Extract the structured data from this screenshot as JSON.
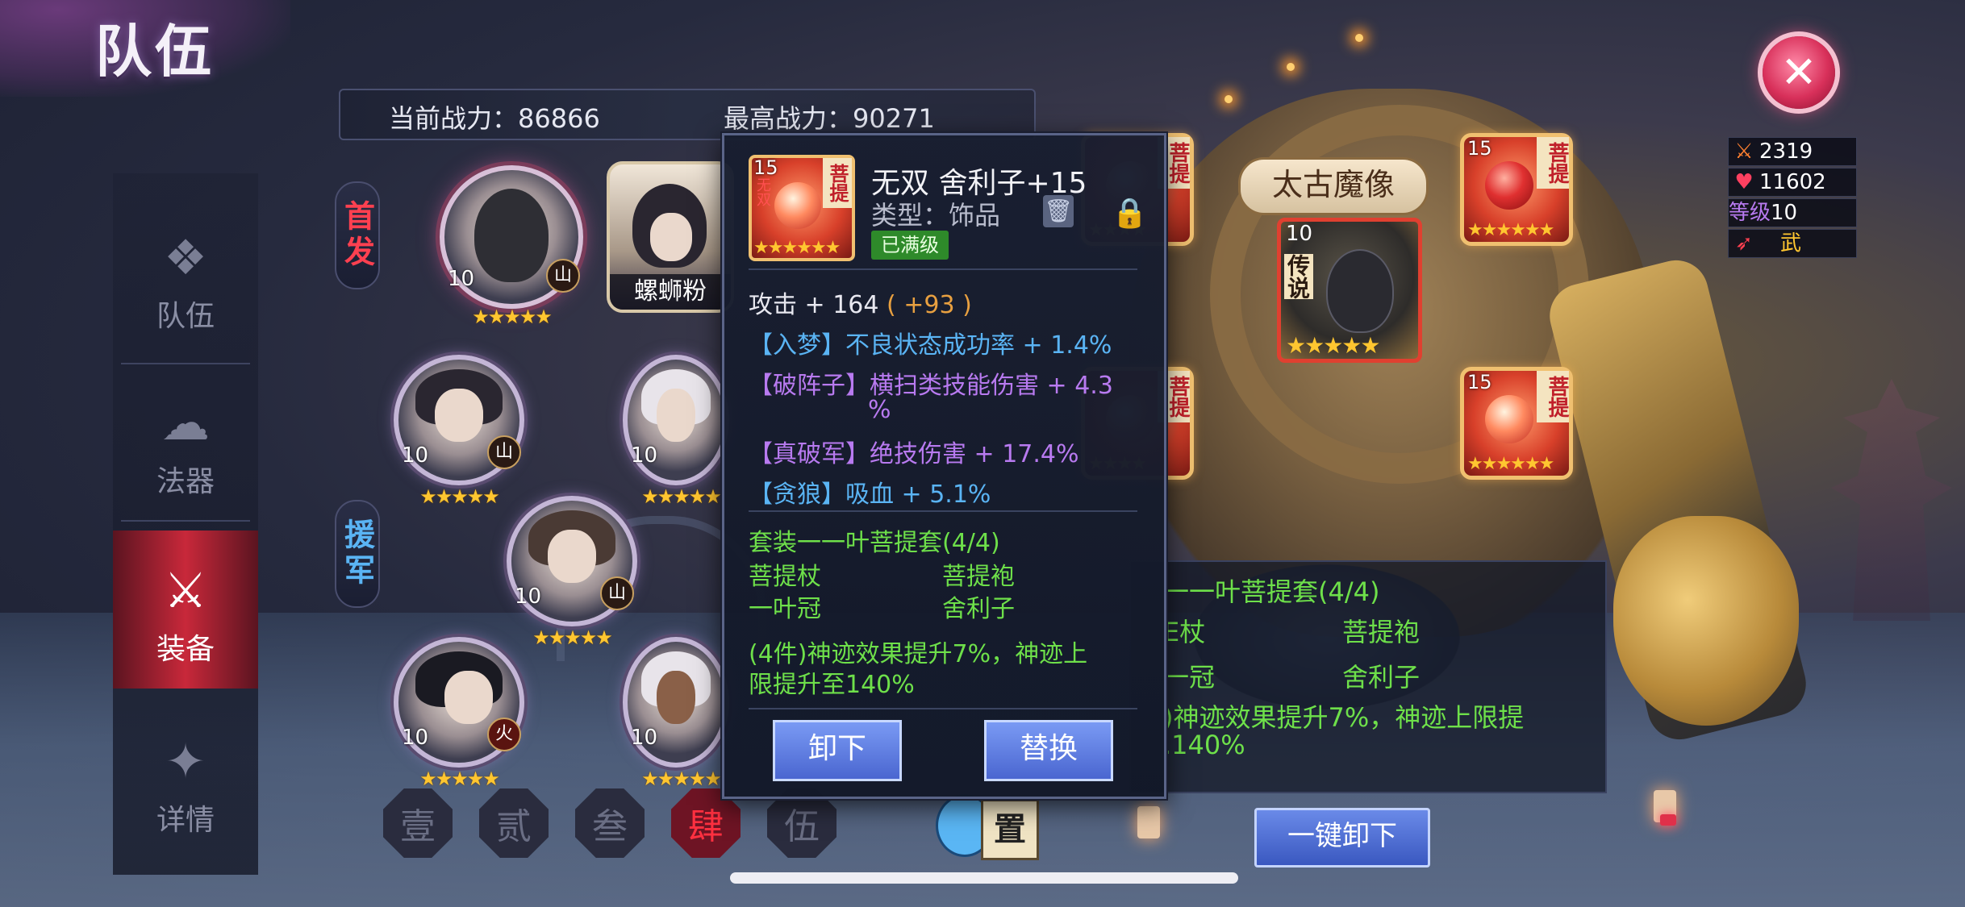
{
  "header": {
    "title": "队伍"
  },
  "power": {
    "current_label": "当前战力：86866",
    "max_label": "最高战力：90271"
  },
  "nav": [
    {
      "label": "队伍",
      "icon": "team-icon"
    },
    {
      "label": "法器",
      "icon": "artifact-icon"
    },
    {
      "label": "装备",
      "icon": "equipment-icon",
      "active": true
    },
    {
      "label": "详情",
      "icon": "details-icon"
    }
  ],
  "side_tags": {
    "starter": "首发",
    "support": "援军"
  },
  "heroes": {
    "lead": {
      "level": "10",
      "element": "山",
      "stars": "★★★★★"
    },
    "named": {
      "name": "螺蛳粉"
    },
    "h2": {
      "level": "10",
      "element": "山",
      "stars": "★★★★★"
    },
    "h3": {
      "level": "10",
      "stars": "★★★★★"
    },
    "h4": {
      "level": "10",
      "element": "山",
      "stars": "★★★★★"
    },
    "h5": {
      "level": "10",
      "element": "火",
      "stars": "★★★★★"
    },
    "h6": {
      "level": "10",
      "stars": "★★★★★"
    }
  },
  "team_tabs": [
    "壹",
    "贰",
    "叁",
    "肆",
    "伍"
  ],
  "active_tab": 3,
  "npc_sign": "置",
  "right": {
    "plaque": "太古魔像",
    "center_equip": {
      "level": "10",
      "tag": "传说",
      "stars": "★★★★★"
    },
    "slots": [
      {
        "level": "",
        "tag": "菩提",
        "stars": "★★★★"
      },
      {
        "level": "15",
        "tag": "菩提",
        "stars": "★★★★★★"
      },
      {
        "level": "",
        "tag": "菩提",
        "stars": "★★★★"
      },
      {
        "level": "15",
        "tag": "菩提",
        "stars": "★★★★★★"
      }
    ],
    "stats": [
      {
        "icon": "sword-icon",
        "value": "2319"
      },
      {
        "icon": "heart-icon",
        "value": "11602"
      },
      {
        "label": "等级",
        "value": "10"
      },
      {
        "icon": "weapon-icon",
        "value": "武"
      }
    ],
    "bg_panel": {
      "set_title": "一一叶菩提套(4/4)",
      "p1": "菩提袍",
      "p2": "舍利子",
      "partial_a": "E杖",
      "partial_b": "一冠",
      "effect": ")神迹效果提升7%，神迹上限提",
      "effect2": ".140%"
    },
    "unequip_all": "一键卸下"
  },
  "tooltip": {
    "icon_level": "15",
    "icon_tag": "菩提",
    "icon_side": "无双",
    "icon_stars": "★★★★★★",
    "name": "无双 舍利子+15",
    "type": "类型：饰品",
    "badge": "已满级",
    "attack": "攻击 + 164",
    "attack_bonus": "( +93 )",
    "affixes": [
      {
        "tag": "【入梦】",
        "text": "不良状态成功率 + 1.4%",
        "color": "blue"
      },
      {
        "tag": "【破阵子】",
        "text": "横扫类技能伤害 + 4.3",
        "color": "purple"
      },
      {
        "tag": "",
        "text": "%",
        "color": "purple"
      },
      {
        "tag": "【真破军】",
        "text": "绝技伤害 + 17.4%",
        "color": "purple"
      },
      {
        "tag": "【贪狼】",
        "text": "吸血 + 5.1%",
        "color": "blue"
      }
    ],
    "set": {
      "title": "套装一一叶菩提套(4/4)",
      "pieces": [
        "菩提杖",
        "菩提袍",
        "一叶冠",
        "舍利子"
      ],
      "effect_line1": "(4件)神迹效果提升7%，神迹上",
      "effect_line2": "限提升至140%"
    },
    "btn_unequip": "卸下",
    "btn_replace": "替换"
  },
  "colors": {
    "accent_red": "#c8283a",
    "set_green": "#6ee04a",
    "affix_purple": "#b87af0",
    "affix_blue": "#5ab4f4",
    "gold": "#ffc630"
  }
}
